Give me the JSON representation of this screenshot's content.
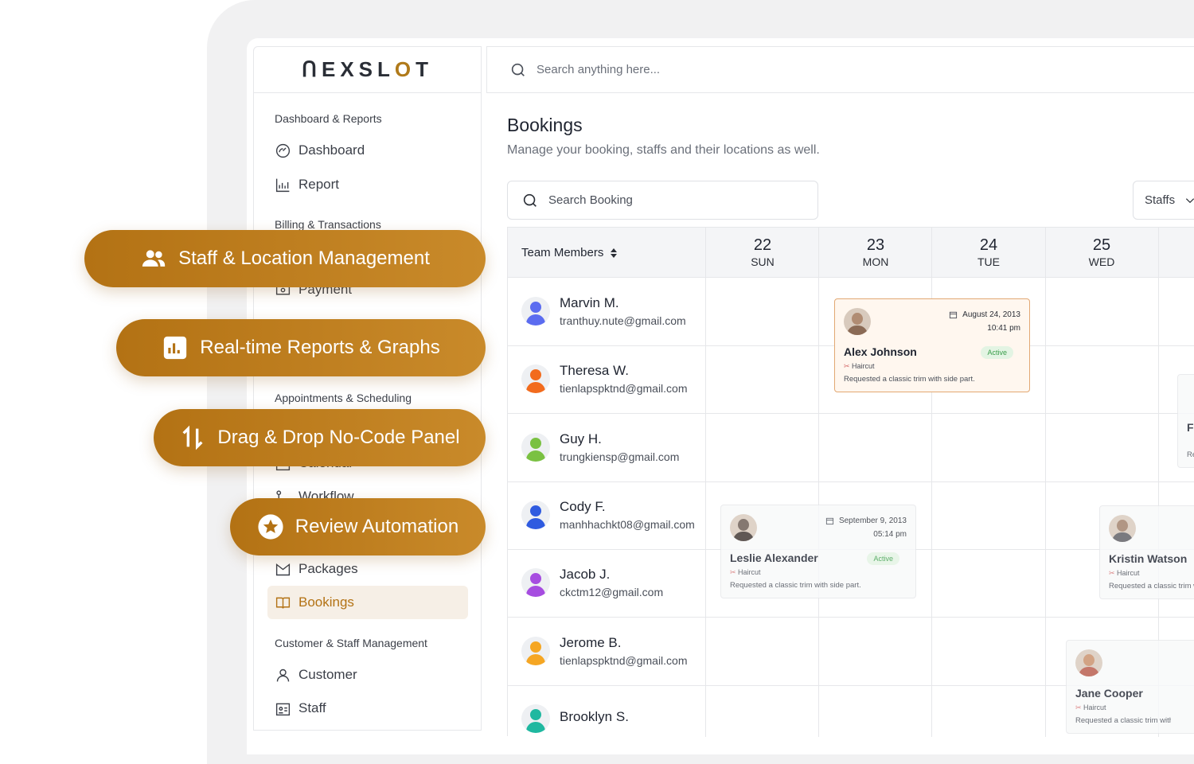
{
  "brand": {
    "logo_text_a": "ᑎEXSL",
    "logo_text_b": "O",
    "logo_text_c": "T"
  },
  "sidebar": {
    "sections": [
      {
        "label": "Dashboard & Reports"
      },
      {
        "label": "Billing & Transactions"
      },
      {
        "label": "Appointments & Scheduling"
      },
      {
        "label": "Customer & Staff Management"
      }
    ],
    "items": [
      {
        "label": "Dashboard",
        "icon": "gauge-icon"
      },
      {
        "label": "Report",
        "icon": "bar-chart-icon"
      },
      {
        "label": "Payment",
        "icon": "payment-icon"
      },
      {
        "label": "Calendar",
        "icon": "calendar-icon"
      },
      {
        "label": "Workflow",
        "icon": "workflow-icon"
      },
      {
        "label": "Packages",
        "icon": "packages-icon"
      },
      {
        "label": "Bookings",
        "icon": "book-icon"
      },
      {
        "label": "Customer",
        "icon": "user-icon"
      },
      {
        "label": "Staff",
        "icon": "staff-card-icon"
      }
    ]
  },
  "topbar": {
    "search_placeholder": "Search anything here..."
  },
  "page": {
    "title": "Bookings",
    "subtitle": "Manage your booking, staffs and their locations as well.",
    "search_placeholder": "Search Booking",
    "filter_label": "Staffs"
  },
  "grid": {
    "team_header": "Team Members",
    "days": [
      {
        "num": "22",
        "name": "SUN"
      },
      {
        "num": "23",
        "name": "MON"
      },
      {
        "num": "24",
        "name": "TUE"
      },
      {
        "num": "25",
        "name": "WED"
      }
    ],
    "members": [
      {
        "name": "Marvin M.",
        "email": "tranthuy.nute@gmail.com",
        "color": "#5b6cf0"
      },
      {
        "name": "Theresa W.",
        "email": "tienlapspktnd@gmail.com",
        "color": "#f26b1d"
      },
      {
        "name": "Guy H.",
        "email": "trungkiensp@gmail.com",
        "color": "#7ac142"
      },
      {
        "name": "Cody F.",
        "email": "manhhachkt08@gmail.com",
        "color": "#2f5be0"
      },
      {
        "name": "Jacob J.",
        "email": "ckctm12@gmail.com",
        "color": "#a64de0"
      },
      {
        "name": "Jerome B.",
        "email": "tienlapspktnd@gmail.com",
        "color": "#f5a623"
      },
      {
        "name": "Brooklyn S.",
        "email": "",
        "color": "#1fb8a0"
      }
    ]
  },
  "bookings": [
    {
      "name": "Alex Johnson",
      "date": "August 24, 2013",
      "time": "10:41 pm",
      "status": "Active",
      "service": "Haircut",
      "note": "Requested a classic trim with side part."
    },
    {
      "name": "Leslie Alexander",
      "date": "September 9, 2013",
      "time": "05:14 pm",
      "status": "Active",
      "service": "Haircut",
      "note": "Requested a classic trim with side part."
    },
    {
      "name": "Kristin Watson",
      "service": "Haircut",
      "note": "Requested a classic trim w"
    },
    {
      "name": "Jane Cooper",
      "service": "Haircut",
      "note": "Requested a classic trim with"
    },
    {
      "name": "Fl",
      "service": "",
      "note": "Re"
    }
  ],
  "features": [
    {
      "label": "Staff & Location Management",
      "icon": "people-icon"
    },
    {
      "label": "Real-time Reports & Graphs",
      "icon": "chart-icon"
    },
    {
      "label": "Drag & Drop No-Code Panel",
      "icon": "sort-arrows-icon"
    },
    {
      "label": "Review Automation",
      "icon": "star-badge-icon"
    }
  ],
  "colors": {
    "accent": "#b37214",
    "active_bg": "#f6efe6",
    "card_border": "#e2a873",
    "badge_green": "#3a9d4a"
  }
}
